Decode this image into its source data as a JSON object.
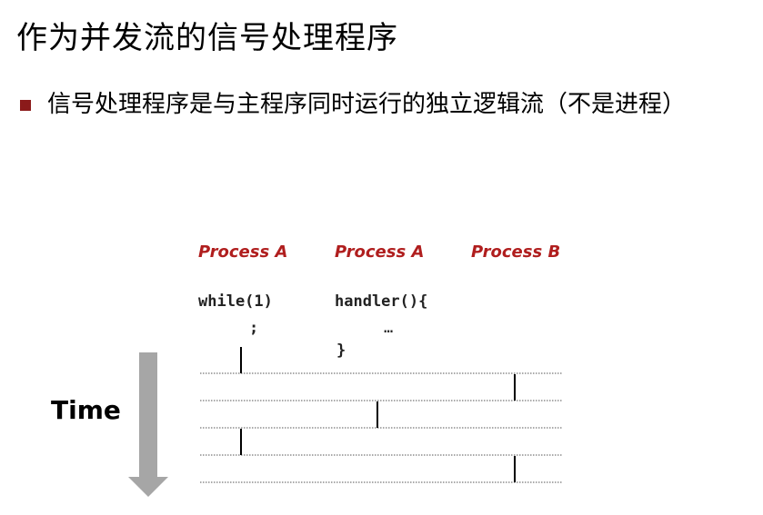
{
  "title": "作为并发流的信号处理程序",
  "bullet": {
    "text": "信号处理程序是与主程序同时运行的独立逻辑流（不是进程）"
  },
  "diagram": {
    "columns": [
      {
        "label": "Process A",
        "code": [
          "while(1)",
          ";",
          ""
        ]
      },
      {
        "label": "Process A",
        "code": [
          "handler(){",
          "…",
          "}"
        ]
      },
      {
        "label": "Process B",
        "code": []
      }
    ],
    "time_label": "Time",
    "segments": [
      {
        "row": 0,
        "column": 0
      },
      {
        "row": 1,
        "column": 2
      },
      {
        "row": 2,
        "column": 1
      },
      {
        "row": 3,
        "column": 0
      },
      {
        "row": 4,
        "column": 2
      }
    ],
    "colors": {
      "label": "#b01e1e",
      "bullet": "#8b1a1a",
      "arrow": "#a6a6a6",
      "line": "#000000"
    }
  }
}
